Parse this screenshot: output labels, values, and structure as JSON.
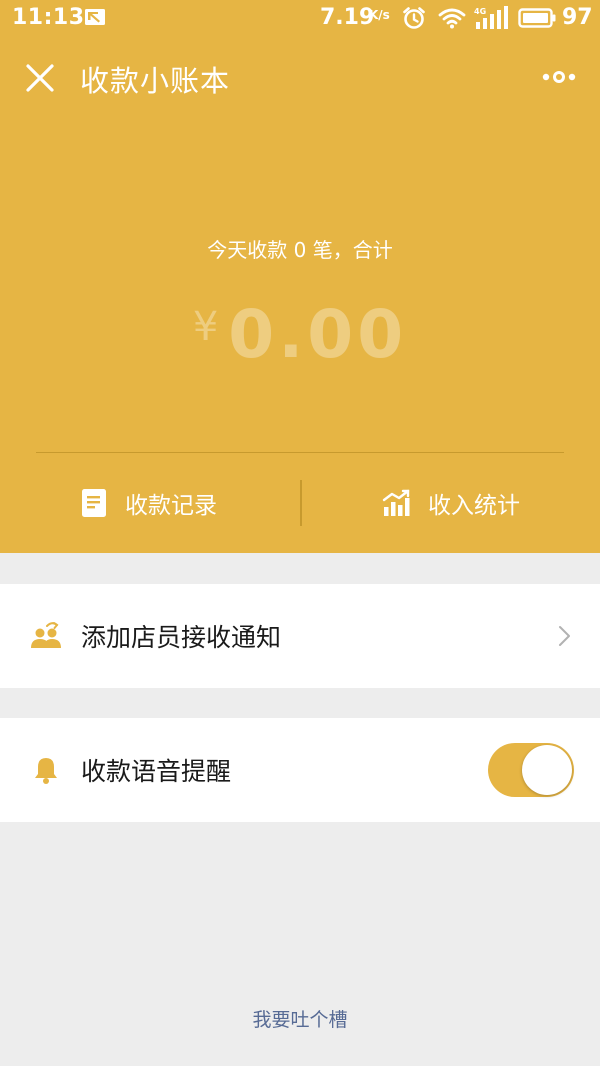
{
  "status_bar": {
    "time": "11:13",
    "network_speed": "7.19",
    "network_speed_unit": "K/s",
    "signal_label": "4G",
    "battery": "97"
  },
  "nav": {
    "title": "收款小账本"
  },
  "summary": {
    "text": "今天收款 0 笔，合计",
    "currency": "¥",
    "amount": "0.00"
  },
  "actions": {
    "records_label": "收款记录",
    "stats_label": "收入统计"
  },
  "settings": {
    "add_staff_label": "添加店员接收通知",
    "voice_reminder_label": "收款语音提醒",
    "voice_reminder_enabled": true
  },
  "footer": {
    "feedback_label": "我要吐个槽"
  },
  "colors": {
    "brand": "#e6b544",
    "background": "#ededed",
    "link": "#576b95"
  }
}
